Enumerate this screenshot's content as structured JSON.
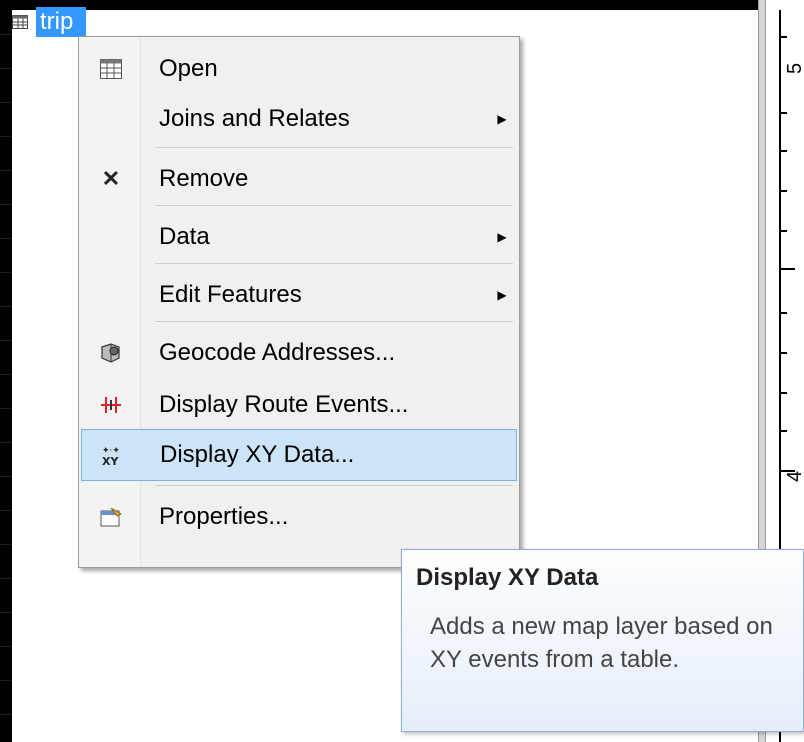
{
  "toc": {
    "layer_label": "trip",
    "layer_icon": "table-icon"
  },
  "ruler": {
    "labels": [
      "5",
      "4"
    ]
  },
  "context_menu": {
    "items": [
      {
        "label": "Open",
        "icon": "table-open-icon",
        "submenu": false
      },
      {
        "label": "Joins and Relates",
        "icon": "",
        "submenu": true
      },
      {
        "label": "Remove",
        "icon": "remove-x-icon",
        "submenu": false
      },
      {
        "label": "Data",
        "icon": "",
        "submenu": true
      },
      {
        "label": "Edit Features",
        "icon": "",
        "submenu": true
      },
      {
        "label": "Geocode Addresses...",
        "icon": "geocode-icon",
        "submenu": false
      },
      {
        "label": "Display Route Events...",
        "icon": "route-events-icon",
        "submenu": false
      },
      {
        "label": "Display XY Data...",
        "icon": "xy-data-icon",
        "submenu": false,
        "highlighted": true
      },
      {
        "label": "Properties...",
        "icon": "properties-icon",
        "submenu": false
      }
    ]
  },
  "tooltip": {
    "title": "Display XY Data",
    "body": "Adds a new map layer based on XY events from a table."
  },
  "colors": {
    "highlight_bg": "#cce4f7",
    "highlight_border": "#7ab4e6",
    "selection_blue": "#3399ff"
  }
}
